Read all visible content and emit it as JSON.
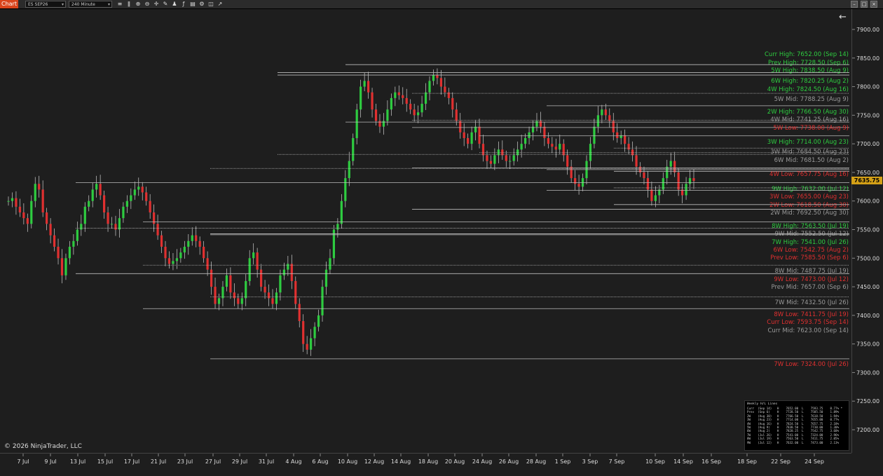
{
  "toolbar": {
    "tab_label": "Chart",
    "instrument": "ES SEP26",
    "interval": "240 Minute",
    "icons": [
      "data-series-icon",
      "bar-type-icon",
      "zoom-in-icon",
      "zoom-out-icon",
      "crosshair-icon",
      "drawing-tools-icon",
      "strategies-icon",
      "indicators-icon",
      "templates-icon",
      "properties-icon",
      "snapshot-icon",
      "share-icon"
    ],
    "window_buttons": [
      "minimize-icon",
      "maximize-icon",
      "close-icon"
    ]
  },
  "copyright": "© 2026 NinjaTrader, LLC",
  "last_price": "7635.75",
  "colors": {
    "up": "#2ecc40",
    "down": "#e03030",
    "green_label": "#2ecc40",
    "red_label": "#e03030",
    "gray_label": "#999999",
    "line": "#bbbbbb"
  },
  "chart_data": {
    "type": "candlestick",
    "instrument": "ES SEP26",
    "interval": "240 Minute",
    "y_ticks": [
      "7900.00",
      "7850.00",
      "7800.00",
      "7750.00",
      "7700.00",
      "7650.00",
      "7600.00",
      "7550.00",
      "7500.00",
      "7450.00",
      "7400.00",
      "7350.00",
      "7300.00",
      "7250.00",
      "7200.00"
    ],
    "ylim": [
      7175,
      7915
    ],
    "x_ticks": [
      "7 Jul",
      "9 Jul",
      "13 Jul",
      "15 Jul",
      "17 Jul",
      "21 Jul",
      "23 Jul",
      "27 Jul",
      "29 Jul",
      "31 Jul",
      "4 Aug",
      "6 Aug",
      "10 Aug",
      "12 Aug",
      "14 Aug",
      "18 Aug",
      "20 Aug",
      "24 Aug",
      "26 Aug",
      "28 Aug",
      "1 Sep",
      "3 Sep",
      "7 Sep",
      "10 Sep",
      "14 Sep",
      "16 Sep",
      "18 Sep",
      "22 Sep",
      "24 Sep"
    ],
    "levels": [
      {
        "label": "Curr High: 7652.00 (Sep 14)",
        "color": "green",
        "price": 7652.0
      },
      {
        "label": "Prev High: 7728.50 (Sep 6)",
        "color": "green",
        "price": 7728.5
      },
      {
        "label": "5W High: 7838.50 (Aug 9)",
        "color": "green",
        "price": 7838.5
      },
      {
        "label": "6W High: 7820.25 (Aug 2)",
        "color": "green",
        "price": 7820.25
      },
      {
        "label": "4W High: 7824.50 (Aug 16)",
        "color": "green",
        "price": 7824.5
      },
      {
        "label": "5W Mid: 7788.25 (Aug 9)",
        "color": "gray",
        "price": 7788.25
      },
      {
        "label": "2W High: 7766.50 (Aug 30)",
        "color": "green",
        "price": 7766.5
      },
      {
        "label": "4W Mid: 7741.25 (Aug 16)",
        "color": "gray",
        "price": 7741.25
      },
      {
        "label": "5W Low: 7738.00 (Aug 9)",
        "color": "red",
        "price": 7738.0
      },
      {
        "label": "3W High: 7714.00 (Aug 23)",
        "color": "green",
        "price": 7714.0
      },
      {
        "label": "3W Mid: 7684.50 (Aug 23)",
        "color": "gray",
        "price": 7684.5
      },
      {
        "label": "6W Mid: 7681.50 (Aug 2)",
        "color": "gray",
        "price": 7681.5
      },
      {
        "label": "4W Low: 7657.75 (Aug 16)",
        "color": "red",
        "price": 7657.75
      },
      {
        "label": "9W High: 7632.00 (Jul 12)",
        "color": "green",
        "price": 7632.0
      },
      {
        "label": "3W Low: 7655.00 (Aug 23)",
        "color": "red",
        "price": 7655.0
      },
      {
        "label": "2W Low: 7618.50 (Aug 30)",
        "color": "red",
        "price": 7618.5
      },
      {
        "label": "2W Mid: 7692.50 (Aug 30)",
        "color": "gray",
        "price": 7692.5
      },
      {
        "label": "8W High: 7563.50 (Jul 19)",
        "color": "green",
        "price": 7563.5
      },
      {
        "label": "9W Mid: 7552.50 (Jul 12)",
        "color": "gray",
        "price": 7552.5
      },
      {
        "label": "7W High: 7541.00 (Jul 26)",
        "color": "green",
        "price": 7541.0
      },
      {
        "label": "6W Low: 7542.75 (Aug 2)",
        "color": "red",
        "price": 7542.75
      },
      {
        "label": "Prev Low: 7585.50 (Sep 6)",
        "color": "red",
        "price": 7585.5
      },
      {
        "label": "8W Mid: 7487.75 (Jul 19)",
        "color": "gray",
        "price": 7487.75
      },
      {
        "label": "9W Low: 7473.00 (Jul 12)",
        "color": "red",
        "price": 7473.0
      },
      {
        "label": "Prev Mid: 7657.00 (Sep 6)",
        "color": "gray",
        "price": 7657.0
      },
      {
        "label": "7W Mid: 7432.50 (Jul 26)",
        "color": "gray",
        "price": 7432.5
      },
      {
        "label": "8W Low: 7411.75 (Jul 19)",
        "color": "red",
        "price": 7411.75
      },
      {
        "label": "Curr Low: 7593.75 (Sep 14)",
        "color": "red",
        "price": 7593.75
      },
      {
        "label": "Curr Mid: 7623.00 (Sep 14)",
        "color": "gray",
        "price": 7623.0
      },
      {
        "label": "7W Low: 7324.00 (Jul 26)",
        "color": "red",
        "price": 7324.0
      }
    ],
    "candles_close": [
      7600,
      7605,
      7590,
      7580,
      7570,
      7560,
      7600,
      7630,
      7620,
      7580,
      7560,
      7540,
      7520,
      7500,
      7470,
      7500,
      7520,
      7530,
      7550,
      7560,
      7590,
      7600,
      7620,
      7630,
      7610,
      7580,
      7560,
      7560,
      7550,
      7570,
      7590,
      7600,
      7610,
      7620,
      7625,
      7615,
      7600,
      7580,
      7560,
      7540,
      7520,
      7500,
      7490,
      7495,
      7500,
      7510,
      7520,
      7530,
      7540,
      7530,
      7520,
      7500,
      7480,
      7450,
      7420,
      7430,
      7450,
      7470,
      7440,
      7430,
      7420,
      7430,
      7460,
      7500,
      7510,
      7480,
      7450,
      7440,
      7430,
      7420,
      7440,
      7470,
      7480,
      7490,
      7460,
      7420,
      7390,
      7350,
      7340,
      7360,
      7380,
      7400,
      7450,
      7480,
      7500,
      7550,
      7560,
      7600,
      7640,
      7670,
      7710,
      7760,
      7800,
      7810,
      7790,
      7760,
      7740,
      7730,
      7740,
      7760,
      7780,
      7790,
      7785,
      7780,
      7770,
      7760,
      7750,
      7755,
      7770,
      7790,
      7810,
      7820,
      7815,
      7800,
      7790,
      7780,
      7760,
      7740,
      7720,
      7710,
      7700,
      7720,
      7730,
      7700,
      7680,
      7670,
      7665,
      7680,
      7690,
      7680,
      7670,
      7670,
      7680,
      7690,
      7700,
      7710,
      7720,
      7730,
      7740,
      7730,
      7710,
      7700,
      7695,
      7690,
      7700,
      7680,
      7660,
      7640,
      7630,
      7625,
      7640,
      7670,
      7700,
      7730,
      7750,
      7760,
      7750,
      7740,
      7720,
      7710,
      7715,
      7700,
      7690,
      7680,
      7660,
      7650,
      7640,
      7620,
      7600,
      7610,
      7620,
      7640,
      7660,
      7670,
      7650,
      7620,
      7610,
      7630,
      7640,
      7635
    ]
  },
  "hl_table": {
    "title": "Weekly H/L Lines",
    "rows": [
      "Curr  (Sep 14)   H    7652.00  L    7593.75    0.77% *",
      "Prev  (Sep 6)    H    7728.50  L    7585.50    1.89%",
      "2W    (Aug 30)   H    7766.50  L    7618.50    1.94%",
      "3W    (Aug 23)   H    7714.00  L    7655.00    0.77%",
      "4W    (Aug 16)   H    7824.50  L    7657.75    2.18%",
      "5W    (Aug 9)    H    7838.50  L    7738.00    1.30%",
      "6W    (Aug 2)    H    7820.25  L    7542.75    3.68%",
      "7W    (Jul 26)   H    7541.00  L    7324.00    2.96%",
      "8W    (Jul 19)   H    7563.50  L    7411.75    2.05%",
      "9W    (Jul 12)   H    7632.00  L    7473.00    2.13%"
    ]
  }
}
